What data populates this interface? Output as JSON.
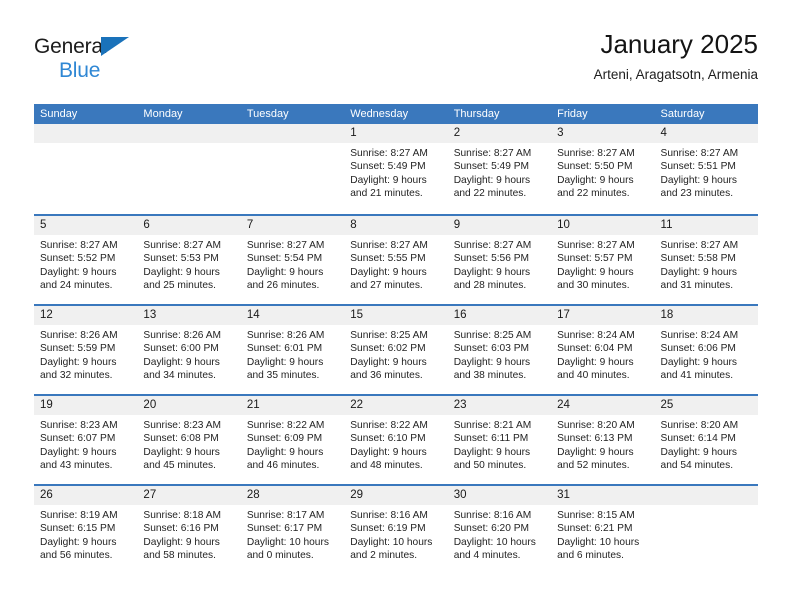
{
  "logo": {
    "word1": "General",
    "word2": "Blue",
    "triangle_color": "#1a72ba",
    "word2_color": "#2f87d4"
  },
  "header": {
    "title": "January 2025",
    "subtitle": "Arteni, Aragatsotn, Armenia"
  },
  "theme": {
    "header_blue": "#3a78bd",
    "day_band_gray": "#f0f0f0",
    "text": "#232323"
  },
  "weekdays": [
    "Sunday",
    "Monday",
    "Tuesday",
    "Wednesday",
    "Thursday",
    "Friday",
    "Saturday"
  ],
  "weeks": [
    [
      {
        "day": ""
      },
      {
        "day": ""
      },
      {
        "day": ""
      },
      {
        "day": "1",
        "sunrise": "Sunrise: 8:27 AM",
        "sunset": "Sunset: 5:49 PM",
        "daylight1": "Daylight: 9 hours",
        "daylight2": "and 21 minutes."
      },
      {
        "day": "2",
        "sunrise": "Sunrise: 8:27 AM",
        "sunset": "Sunset: 5:49 PM",
        "daylight1": "Daylight: 9 hours",
        "daylight2": "and 22 minutes."
      },
      {
        "day": "3",
        "sunrise": "Sunrise: 8:27 AM",
        "sunset": "Sunset: 5:50 PM",
        "daylight1": "Daylight: 9 hours",
        "daylight2": "and 22 minutes."
      },
      {
        "day": "4",
        "sunrise": "Sunrise: 8:27 AM",
        "sunset": "Sunset: 5:51 PM",
        "daylight1": "Daylight: 9 hours",
        "daylight2": "and 23 minutes."
      }
    ],
    [
      {
        "day": "5",
        "sunrise": "Sunrise: 8:27 AM",
        "sunset": "Sunset: 5:52 PM",
        "daylight1": "Daylight: 9 hours",
        "daylight2": "and 24 minutes."
      },
      {
        "day": "6",
        "sunrise": "Sunrise: 8:27 AM",
        "sunset": "Sunset: 5:53 PM",
        "daylight1": "Daylight: 9 hours",
        "daylight2": "and 25 minutes."
      },
      {
        "day": "7",
        "sunrise": "Sunrise: 8:27 AM",
        "sunset": "Sunset: 5:54 PM",
        "daylight1": "Daylight: 9 hours",
        "daylight2": "and 26 minutes."
      },
      {
        "day": "8",
        "sunrise": "Sunrise: 8:27 AM",
        "sunset": "Sunset: 5:55 PM",
        "daylight1": "Daylight: 9 hours",
        "daylight2": "and 27 minutes."
      },
      {
        "day": "9",
        "sunrise": "Sunrise: 8:27 AM",
        "sunset": "Sunset: 5:56 PM",
        "daylight1": "Daylight: 9 hours",
        "daylight2": "and 28 minutes."
      },
      {
        "day": "10",
        "sunrise": "Sunrise: 8:27 AM",
        "sunset": "Sunset: 5:57 PM",
        "daylight1": "Daylight: 9 hours",
        "daylight2": "and 30 minutes."
      },
      {
        "day": "11",
        "sunrise": "Sunrise: 8:27 AM",
        "sunset": "Sunset: 5:58 PM",
        "daylight1": "Daylight: 9 hours",
        "daylight2": "and 31 minutes."
      }
    ],
    [
      {
        "day": "12",
        "sunrise": "Sunrise: 8:26 AM",
        "sunset": "Sunset: 5:59 PM",
        "daylight1": "Daylight: 9 hours",
        "daylight2": "and 32 minutes."
      },
      {
        "day": "13",
        "sunrise": "Sunrise: 8:26 AM",
        "sunset": "Sunset: 6:00 PM",
        "daylight1": "Daylight: 9 hours",
        "daylight2": "and 34 minutes."
      },
      {
        "day": "14",
        "sunrise": "Sunrise: 8:26 AM",
        "sunset": "Sunset: 6:01 PM",
        "daylight1": "Daylight: 9 hours",
        "daylight2": "and 35 minutes."
      },
      {
        "day": "15",
        "sunrise": "Sunrise: 8:25 AM",
        "sunset": "Sunset: 6:02 PM",
        "daylight1": "Daylight: 9 hours",
        "daylight2": "and 36 minutes."
      },
      {
        "day": "16",
        "sunrise": "Sunrise: 8:25 AM",
        "sunset": "Sunset: 6:03 PM",
        "daylight1": "Daylight: 9 hours",
        "daylight2": "and 38 minutes."
      },
      {
        "day": "17",
        "sunrise": "Sunrise: 8:24 AM",
        "sunset": "Sunset: 6:04 PM",
        "daylight1": "Daylight: 9 hours",
        "daylight2": "and 40 minutes."
      },
      {
        "day": "18",
        "sunrise": "Sunrise: 8:24 AM",
        "sunset": "Sunset: 6:06 PM",
        "daylight1": "Daylight: 9 hours",
        "daylight2": "and 41 minutes."
      }
    ],
    [
      {
        "day": "19",
        "sunrise": "Sunrise: 8:23 AM",
        "sunset": "Sunset: 6:07 PM",
        "daylight1": "Daylight: 9 hours",
        "daylight2": "and 43 minutes."
      },
      {
        "day": "20",
        "sunrise": "Sunrise: 8:23 AM",
        "sunset": "Sunset: 6:08 PM",
        "daylight1": "Daylight: 9 hours",
        "daylight2": "and 45 minutes."
      },
      {
        "day": "21",
        "sunrise": "Sunrise: 8:22 AM",
        "sunset": "Sunset: 6:09 PM",
        "daylight1": "Daylight: 9 hours",
        "daylight2": "and 46 minutes."
      },
      {
        "day": "22",
        "sunrise": "Sunrise: 8:22 AM",
        "sunset": "Sunset: 6:10 PM",
        "daylight1": "Daylight: 9 hours",
        "daylight2": "and 48 minutes."
      },
      {
        "day": "23",
        "sunrise": "Sunrise: 8:21 AM",
        "sunset": "Sunset: 6:11 PM",
        "daylight1": "Daylight: 9 hours",
        "daylight2": "and 50 minutes."
      },
      {
        "day": "24",
        "sunrise": "Sunrise: 8:20 AM",
        "sunset": "Sunset: 6:13 PM",
        "daylight1": "Daylight: 9 hours",
        "daylight2": "and 52 minutes."
      },
      {
        "day": "25",
        "sunrise": "Sunrise: 8:20 AM",
        "sunset": "Sunset: 6:14 PM",
        "daylight1": "Daylight: 9 hours",
        "daylight2": "and 54 minutes."
      }
    ],
    [
      {
        "day": "26",
        "sunrise": "Sunrise: 8:19 AM",
        "sunset": "Sunset: 6:15 PM",
        "daylight1": "Daylight: 9 hours",
        "daylight2": "and 56 minutes."
      },
      {
        "day": "27",
        "sunrise": "Sunrise: 8:18 AM",
        "sunset": "Sunset: 6:16 PM",
        "daylight1": "Daylight: 9 hours",
        "daylight2": "and 58 minutes."
      },
      {
        "day": "28",
        "sunrise": "Sunrise: 8:17 AM",
        "sunset": "Sunset: 6:17 PM",
        "daylight1": "Daylight: 10 hours",
        "daylight2": "and 0 minutes."
      },
      {
        "day": "29",
        "sunrise": "Sunrise: 8:16 AM",
        "sunset": "Sunset: 6:19 PM",
        "daylight1": "Daylight: 10 hours",
        "daylight2": "and 2 minutes."
      },
      {
        "day": "30",
        "sunrise": "Sunrise: 8:16 AM",
        "sunset": "Sunset: 6:20 PM",
        "daylight1": "Daylight: 10 hours",
        "daylight2": "and 4 minutes."
      },
      {
        "day": "31",
        "sunrise": "Sunrise: 8:15 AM",
        "sunset": "Sunset: 6:21 PM",
        "daylight1": "Daylight: 10 hours",
        "daylight2": "and 6 minutes."
      },
      {
        "day": ""
      }
    ]
  ]
}
